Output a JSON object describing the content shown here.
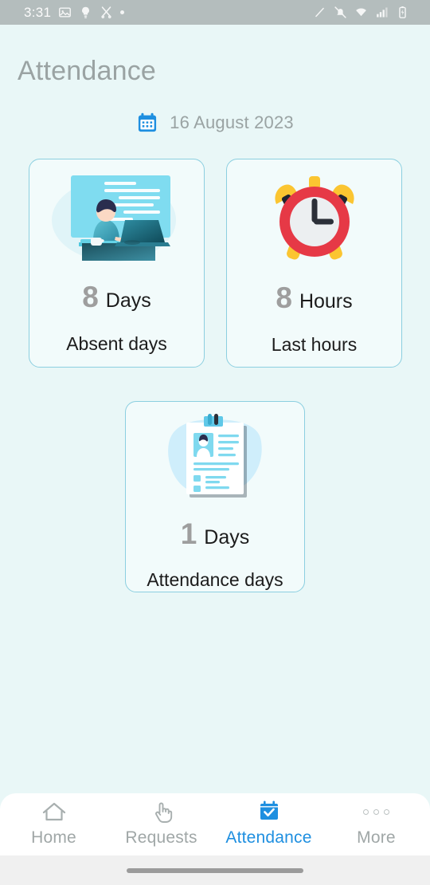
{
  "status_bar": {
    "time": "3:31",
    "left_icons": [
      "image-icon",
      "lightbulb-icon",
      "scissors-icon",
      "dot-icon"
    ],
    "right_icons": [
      "pencil-slash-icon",
      "notifications-muted-icon",
      "wifi-icon",
      "cellular-signal-icon",
      "battery-icon"
    ],
    "background_color": "#b4bdbd"
  },
  "header": {
    "title": "Attendance",
    "title_color": "#9aa3a3"
  },
  "date_row": {
    "icon": "calendar-icon",
    "icon_color": "#1e8fe0",
    "date": "16 August 2023",
    "text_color": "#9aa3a3"
  },
  "cards": [
    {
      "id": "absent",
      "illustration": "person-at-desk-illustration",
      "value": "8",
      "unit": "Days",
      "label": "Absent days"
    },
    {
      "id": "hours",
      "illustration": "alarm-clock-illustration",
      "value": "8",
      "unit": "Hours",
      "label": "Last hours"
    },
    {
      "id": "attendance",
      "illustration": "resume-clipboard-illustration",
      "value": "1",
      "unit": "Days",
      "label": "Attendance days"
    }
  ],
  "card_style": {
    "border_color": "#8ccfe0",
    "background_color": "#f2fbfb",
    "value_color": "#9e9e9e",
    "unit_color": "#1c1c1c"
  },
  "bottom_nav": {
    "items": [
      {
        "label": "Home",
        "icon": "home-icon",
        "active": false
      },
      {
        "label": "Requests",
        "icon": "pointing-hand-icon",
        "active": false
      },
      {
        "label": "Attendance",
        "icon": "calendar-check-icon",
        "active": true
      },
      {
        "label": "More",
        "icon": "three-dots-icon",
        "active": false
      }
    ],
    "active_color": "#1e8fe0",
    "inactive_color": "#a0a7a7",
    "background_color": "#ffffff"
  },
  "page": {
    "background_color": "#e9f7f7"
  },
  "gesture_bar": {
    "indicator": "home-indicator-pill",
    "background_color": "#f0f0f0"
  }
}
